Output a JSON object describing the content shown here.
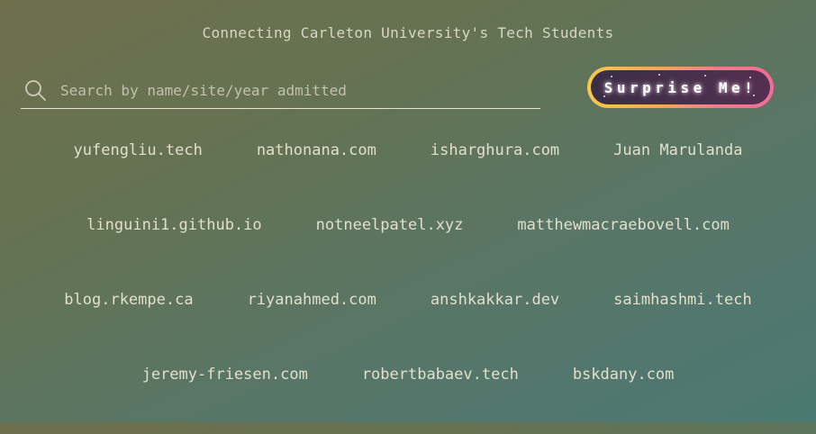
{
  "header": {
    "tagline": "Connecting Carleton University's Tech Students"
  },
  "search": {
    "placeholder": "Search by name/site/year admitted",
    "value": "",
    "icon": "search-icon"
  },
  "surprise_button": {
    "label": "Surprise Me!",
    "border_colors": [
      "#f5c94a",
      "#f16c97"
    ]
  },
  "sites": {
    "rows": [
      [
        "yufengliu.tech",
        "nathonana.com",
        "isharghura.com",
        "Juan Marulanda"
      ],
      [
        "linguini1.github.io",
        "notneelpatel.xyz",
        "matthewmacraebovell.com"
      ],
      [
        "blog.rkempe.ca",
        "riyanahmed.com",
        "anshkakkar.dev",
        "saimhashmi.tech"
      ],
      [
        "jeremy-friesen.com",
        "robertbabaev.tech",
        "bskdany.com"
      ]
    ]
  }
}
